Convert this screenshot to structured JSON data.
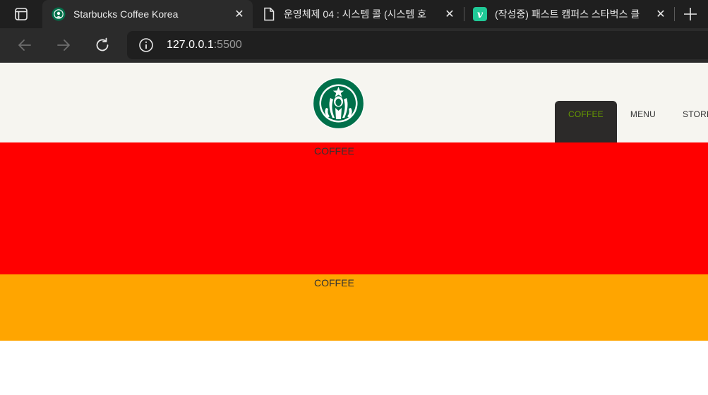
{
  "browser": {
    "tabs": [
      {
        "title": "Starbucks Coffee Korea",
        "active": true,
        "icon": "starbucks-favicon"
      },
      {
        "title": "운영체제 04 : 시스템 콜 (시스템 호",
        "active": false,
        "icon": "document-icon"
      },
      {
        "title": "(작성중) 패스트 캠퍼스 스타벅스 클",
        "active": false,
        "icon": "velog-icon"
      }
    ],
    "address": {
      "host": "127.0.0.1",
      "port": ":5500"
    }
  },
  "page": {
    "header": {
      "logo": "starbucks-logo",
      "menu": [
        "COFFEE",
        "MENU",
        "STORE"
      ]
    },
    "sections": [
      {
        "label": "COFFEE",
        "color": "#ff0000"
      },
      {
        "label": "COFFEE",
        "color": "#ffa500"
      }
    ]
  },
  "colors": {
    "header_bg": "#f6f5f0",
    "menu_active_bg": "#2c2a29",
    "menu_active_text": "#669900"
  }
}
